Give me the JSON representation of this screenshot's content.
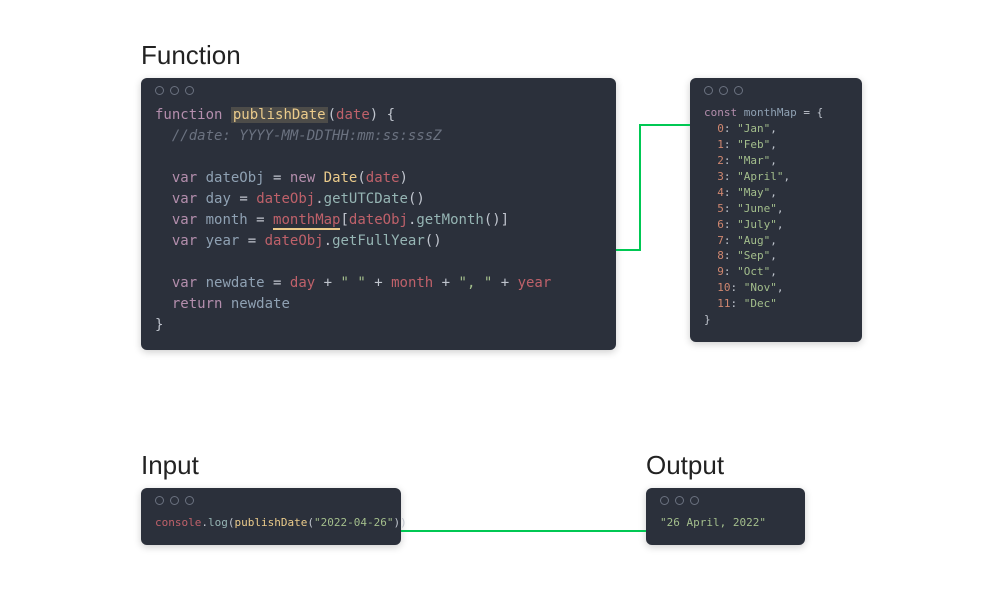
{
  "headings": {
    "function": "Function",
    "input": "Input",
    "output": "Output"
  },
  "functionCode": {
    "kw_function": "function",
    "fn_name": "publishDate",
    "param": "date",
    "comment": "//date: YYYY-MM-DDTHH:mm:ss:sssZ",
    "var": "var",
    "eq": " = ",
    "new": "new",
    "DateCtor": "Date",
    "dateObj": "dateObj",
    "day": "day",
    "month": "month",
    "year": "year",
    "newdate": "newdate",
    "getUTCDate": "getUTCDate",
    "monthMap": "monthMap",
    "getMonth": "getMonth",
    "getFullYear": "getFullYear",
    "plus": " + ",
    "space_str": "\" \"",
    "comma_str": "\", \"",
    "return": "return"
  },
  "monthMapCode": {
    "const": "const",
    "name": "monthMap",
    "entries": [
      {
        "k": "0",
        "v": "\"Jan\""
      },
      {
        "k": "1",
        "v": "\"Feb\""
      },
      {
        "k": "2",
        "v": "\"Mar\""
      },
      {
        "k": "3",
        "v": "\"April\""
      },
      {
        "k": "4",
        "v": "\"May\""
      },
      {
        "k": "5",
        "v": "\"June\""
      },
      {
        "k": "6",
        "v": "\"July\""
      },
      {
        "k": "7",
        "v": "\"Aug\""
      },
      {
        "k": "8",
        "v": "\"Sep\""
      },
      {
        "k": "9",
        "v": "\"Oct\""
      },
      {
        "k": "10",
        "v": "\"Nov\""
      },
      {
        "k": "11",
        "v": "\"Dec\""
      }
    ]
  },
  "inputCode": {
    "console": "console",
    "log": "log",
    "call": "publishDate",
    "arg": "\"2022-04-26\""
  },
  "outputCode": {
    "value": "\"26 April, 2022\""
  }
}
